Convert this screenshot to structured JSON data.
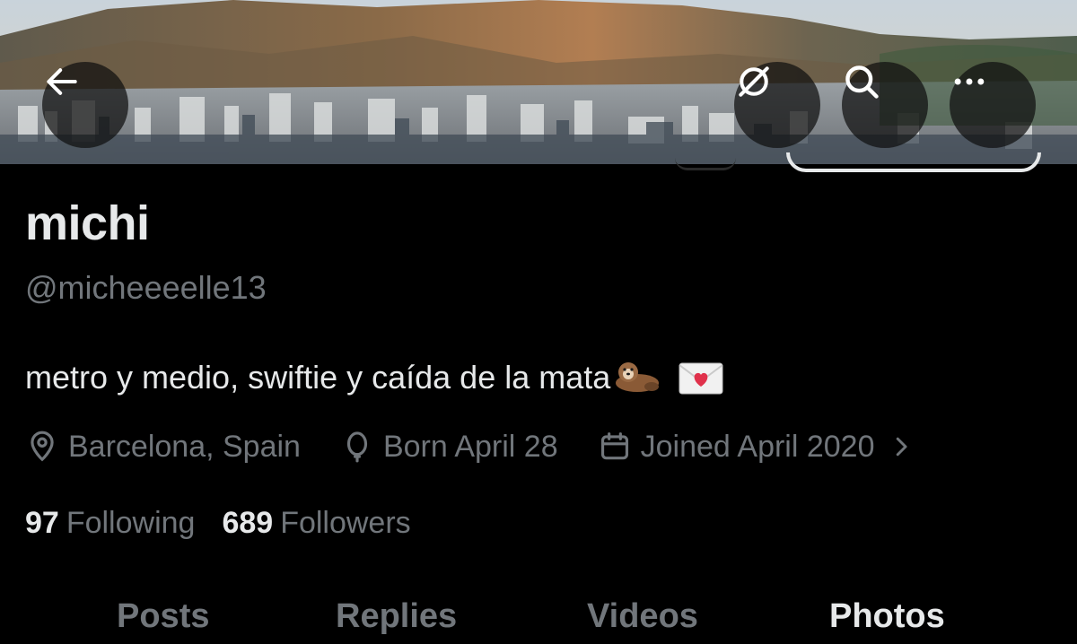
{
  "header": {
    "back_icon": "arrow-left-icon",
    "grok_icon": "grok-slash-icon",
    "search_icon": "search-icon",
    "more_icon": "more-horizontal-icon"
  },
  "profile": {
    "name": "michi",
    "handle": "@micheeeelle13",
    "bio": "metro y medio, swiftie y caída de la mata",
    "bio_emojis": [
      "otter-emoji",
      "love-letter-emoji"
    ],
    "location": "Barcelona, Spain",
    "birthday": "Born April 28",
    "joined": "Joined April 2020"
  },
  "stats": {
    "following_count": "97",
    "following_label": "Following",
    "followers_count": "689",
    "followers_label": "Followers"
  },
  "tabs": [
    {
      "label": "Posts",
      "active": false
    },
    {
      "label": "Replies",
      "active": false
    },
    {
      "label": "Videos",
      "active": false
    },
    {
      "label": "Photos",
      "active": true
    }
  ],
  "colors": {
    "background": "#000000",
    "primary_text": "#e7e9ea",
    "secondary_text": "#71767b"
  }
}
